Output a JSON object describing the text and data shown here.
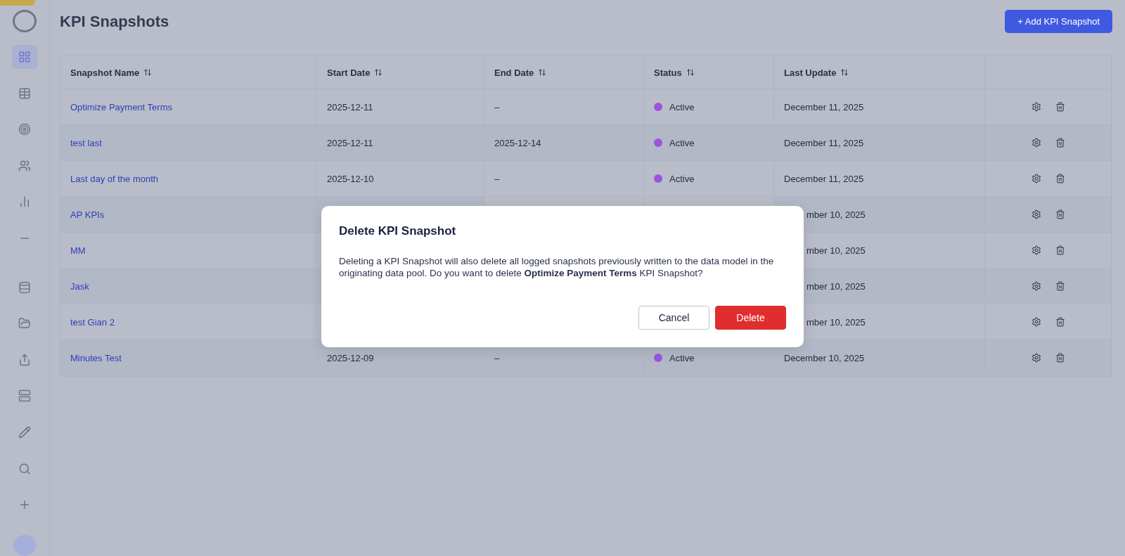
{
  "page": {
    "title": "KPI Snapshots",
    "add_button": "+ Add KPI Snapshot"
  },
  "table": {
    "columns": [
      "Snapshot Name",
      "Start Date",
      "End Date",
      "Status",
      "Last Update"
    ],
    "rows": [
      {
        "name": "Optimize Payment Terms",
        "start_date": "2025-12-11",
        "end_date": "–",
        "status": "Active",
        "color": "#9a55e0",
        "last_update": "December 11, 2025"
      },
      {
        "name": "test last",
        "start_date": "2025-12-11",
        "end_date": "2025-12-14",
        "status": "Active",
        "color": "#9a55e0",
        "last_update": "December 11, 2025"
      },
      {
        "name": "Last day of the month",
        "start_date": "2025-12-10",
        "end_date": "–",
        "status": "Active",
        "color": "#9a55e0",
        "last_update": "December 11, 2025"
      },
      {
        "name": "AP KPIs",
        "last_update": "mber 10, 2025"
      },
      {
        "name": "MM",
        "last_update": "mber 10, 2025"
      },
      {
        "name": "Jask",
        "last_update": "mber 10, 2025"
      },
      {
        "name": "test Gian 2",
        "last_update": "mber 10, 2025"
      },
      {
        "name": "Minutes Test",
        "start_date": "2025-12-09",
        "end_date": "–",
        "status": "Active",
        "color": "#9a55e0",
        "last_update": "December 10, 2025"
      }
    ]
  },
  "dialog": {
    "title": "Delete KPI Snapshot",
    "message": "Deleting a KPI Snapshot will also delete all logged snapshots previously written to the data model in the originating data pool. Do you want to delete **Optimize Payment Terms** KPI Snapshot?",
    "buttons": [
      {
        "label": "Cancel",
        "kind": "secondary"
      },
      {
        "label": "Delete",
        "kind": "danger"
      }
    ]
  }
}
